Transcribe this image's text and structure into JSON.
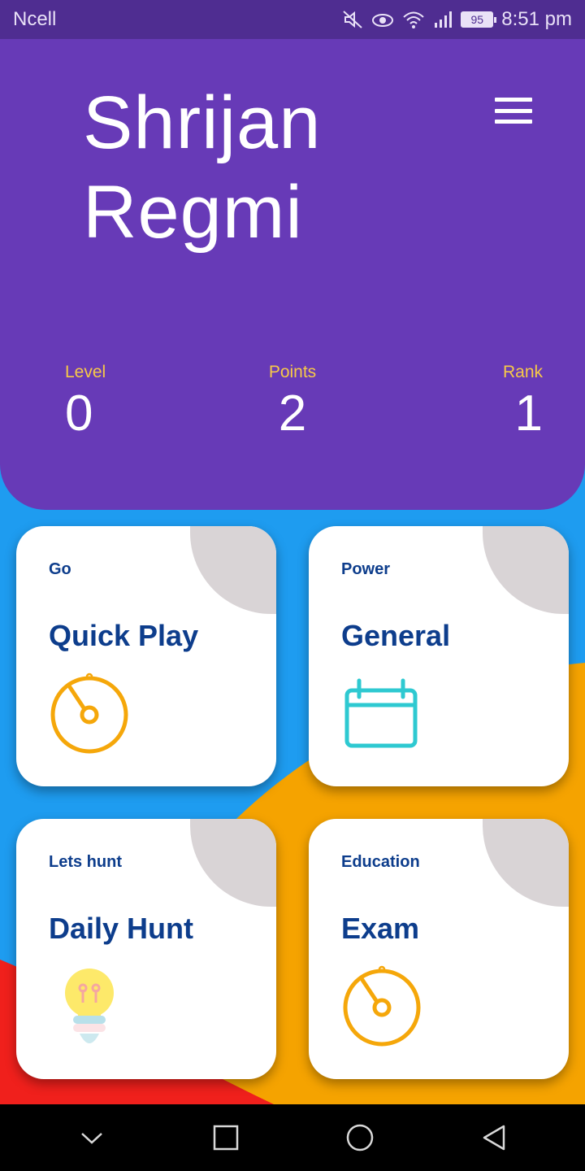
{
  "status_bar": {
    "carrier": "Ncell",
    "battery": "95",
    "time": "8:51 pm",
    "icons": [
      "mute-icon",
      "eye-icon",
      "wifi-icon",
      "signal-icon",
      "battery-icon"
    ]
  },
  "header": {
    "name_line1": "Shrijan",
    "name_line2": "Regmi",
    "menu_icon": "hamburger-menu-icon",
    "background_color": "#673ab7"
  },
  "stats": {
    "level": {
      "label": "Level",
      "value": "0"
    },
    "points": {
      "label": "Points",
      "value": "2"
    },
    "rank": {
      "label": "Rank",
      "value": "1"
    }
  },
  "cards": [
    {
      "subtitle": "Go",
      "title": "Quick Play",
      "icon": "stopwatch-icon"
    },
    {
      "subtitle": "Power",
      "title": "General",
      "icon": "calendar-icon"
    },
    {
      "subtitle": "Lets hunt",
      "title": "Daily Hunt",
      "icon": "lightbulb-icon"
    },
    {
      "subtitle": "Education",
      "title": "Exam",
      "icon": "stopwatch-icon"
    }
  ],
  "nav_bar": {
    "icons": [
      "chevron-down-icon",
      "recent-apps-icon",
      "home-icon",
      "back-icon"
    ]
  },
  "colors": {
    "accent_title": "#0d3d8c",
    "stat_label": "#f7c948",
    "icon_orange": "#f5a70a",
    "icon_teal": "#2ec9d1",
    "background_blue": "#1e9cf0",
    "background_orange": "#f5a300",
    "background_red": "#f0201c"
  }
}
